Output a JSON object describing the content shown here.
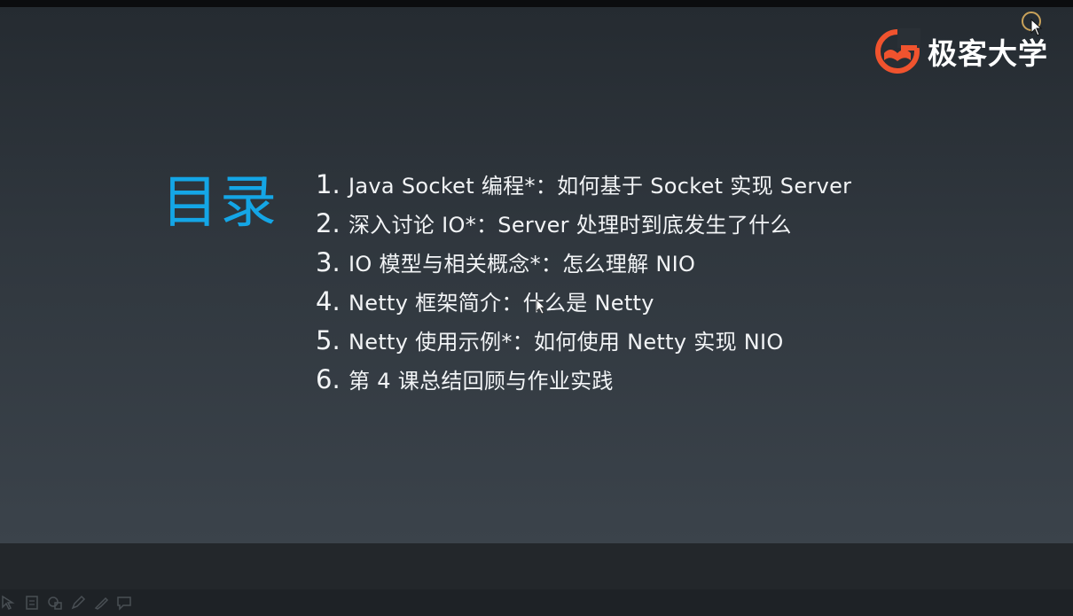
{
  "brand": {
    "name": "极客大学",
    "accent": "#f0532e"
  },
  "toc": {
    "title": "目录",
    "title_color": "#14a6e6",
    "items": [
      {
        "num": "1.",
        "text": "Java Socket 编程*：如何基于 Socket 实现 Server"
      },
      {
        "num": "2.",
        "text": "深入讨论 IO*：Server 处理时到底发生了什么"
      },
      {
        "num": "3.",
        "text": "IO 模型与相关概念*：怎么理解 NIO"
      },
      {
        "num": "4.",
        "text": "Netty 框架简介：什么是 Netty"
      },
      {
        "num": "5.",
        "text": "Netty 使用示例*：如何使用 Netty 实现 NIO"
      },
      {
        "num": "6.",
        "text": "第 4 课总结回顾与作业实践"
      }
    ]
  },
  "toolbar": {
    "icons": [
      "pointer-icon",
      "document-icon",
      "shapes-icon",
      "pen-icon",
      "highlighter-icon",
      "comment-icon"
    ]
  }
}
